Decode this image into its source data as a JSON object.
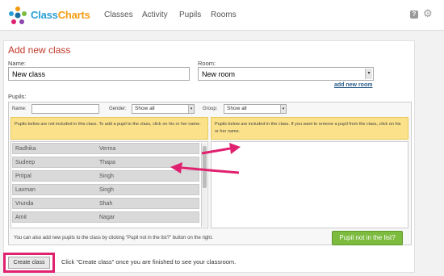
{
  "app": {
    "logo_part1": "Class",
    "logo_part2": "Charts",
    "nav": [
      "Classes",
      "Activity",
      "Pupils",
      "Rooms"
    ]
  },
  "form": {
    "title": "Add new class",
    "name_label": "Name:",
    "name_value": "New class",
    "room_label": "Room:",
    "room_value": "New room",
    "add_room_link": "add new room",
    "pupils_label": "Pupils:"
  },
  "filters": {
    "name_label": "Name:",
    "gender_label": "Gender:",
    "gender_value": "Show all",
    "group_label": "Group:",
    "group_value": "Show all"
  },
  "info": {
    "left": "Pupils below are not included in this class. To add a pupil to the class, click on his or her name.",
    "right": "Pupils below are included in the class. If you want to remove a pupil from the class, click on his or her name."
  },
  "pupils": [
    {
      "first": "Radhika",
      "last": "Verma"
    },
    {
      "first": "Sudeep",
      "last": "Thapa"
    },
    {
      "first": "Pritpal",
      "last": "Singh"
    },
    {
      "first": "Laxman",
      "last": "Singh"
    },
    {
      "first": "Vrunda",
      "last": "Shah"
    },
    {
      "first": "Amit",
      "last": "Nagar"
    }
  ],
  "footer": {
    "note": "You can also add new pupils to the class by clicking \"Pupil not in the list?\" button on the right.",
    "pupil_not_in_list": "Pupil not in the list?",
    "create_button": "Create class",
    "create_hint": "Click \"Create class\" once you are finished to see your classroom."
  },
  "colors": {
    "title": "#c0392b",
    "highlight": "#e0216f",
    "info_bg": "#fbe28a",
    "green_button": "#7cbb3e"
  },
  "icons": [
    "logo-icon",
    "help-icon",
    "gear-icon",
    "dropdown-arrow-icon",
    "arrow-right-icon",
    "arrow-left-icon"
  ]
}
